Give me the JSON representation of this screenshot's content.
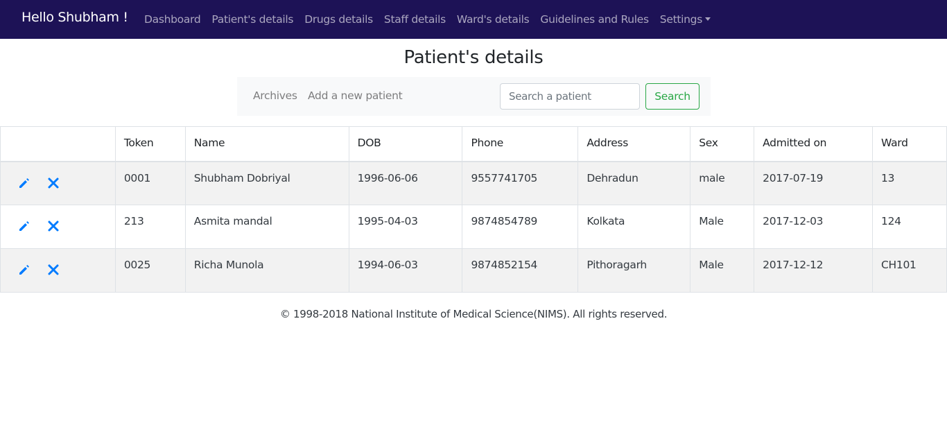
{
  "nav": {
    "brand": "Hello Shubham !",
    "items": [
      {
        "label": "Dashboard"
      },
      {
        "label": "Patient's details"
      },
      {
        "label": "Drugs details"
      },
      {
        "label": "Staff details"
      },
      {
        "label": "Ward's details"
      },
      {
        "label": "Guidelines and Rules"
      },
      {
        "label": "Settings"
      }
    ],
    "background": "#1d1256"
  },
  "page": {
    "title": "Patient's details"
  },
  "subnav": {
    "archives": "Archives",
    "add_patient": "Add a new patient",
    "search_placeholder": "Search a patient",
    "search_button": "Search"
  },
  "table": {
    "columns": [
      "",
      "Token",
      "Name",
      "DOB",
      "Phone",
      "Address",
      "Sex",
      "Admitted on",
      "Ward"
    ],
    "rows": [
      {
        "token": "0001",
        "name": "Shubham Dobriyal",
        "dob": "1996-06-06",
        "phone": "9557741705",
        "address": "Dehradun",
        "sex": "male",
        "admitted": "2017-07-19",
        "ward": "13"
      },
      {
        "token": "213",
        "name": "Asmita mandal",
        "dob": "1995-04-03",
        "phone": "9874854789",
        "address": "Kolkata",
        "sex": "Male",
        "admitted": "2017-12-03",
        "ward": "124"
      },
      {
        "token": "0025",
        "name": "Richa Munola",
        "dob": "1994-06-03",
        "phone": "9874852154",
        "address": "Pithoragarh",
        "sex": "Male",
        "admitted": "2017-12-12",
        "ward": "CH101"
      }
    ],
    "row_icons": [
      "pencil-icon",
      "close-icon"
    ],
    "icon_color": "#007bff"
  },
  "footer": {
    "text": "© 1998-2018 National Institute of Medical Science(NIMS). All rights reserved."
  }
}
